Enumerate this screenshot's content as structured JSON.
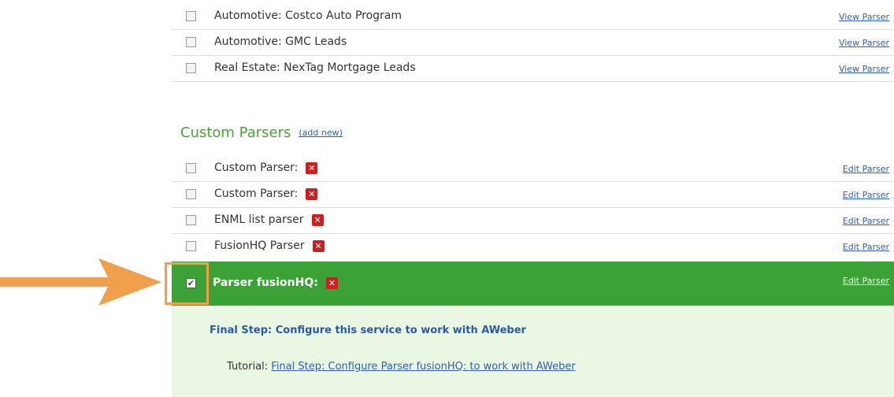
{
  "prebuilt_parsers": [
    {
      "label": "Automotive: Costco Auto Program",
      "action": "View Parser"
    },
    {
      "label": "Automotive: GMC Leads",
      "action": "View Parser"
    },
    {
      "label": "Real Estate: NexTag Mortgage Leads",
      "action": "View Parser"
    }
  ],
  "custom_section": {
    "title": "Custom Parsers",
    "add_new": "(add new)"
  },
  "custom_parsers": [
    {
      "label": "Custom Parser:",
      "action": "Edit Parser"
    },
    {
      "label": "Custom Parser:",
      "action": "Edit Parser"
    },
    {
      "label": "ENML list parser",
      "action": "Edit Parser"
    },
    {
      "label": "FusionHQ Parser",
      "action": "Edit Parser"
    }
  ],
  "selected_parser": {
    "label": "Parser fusionHQ:",
    "action": "Edit Parser",
    "checked": true
  },
  "panel": {
    "final_step": "Final Step: Configure this service to work with AWeber",
    "tutorial_label": "Tutorial:",
    "tutorial_link": "Final Step: Configure Parser fusionHQ: to work with AWeber"
  },
  "icons": {
    "delete": "x-icon",
    "checkmark": "check-icon",
    "arrow": "arrow-right-icon"
  },
  "colors": {
    "selected_row": "#3aa236",
    "panel_bg": "#e9f7e3",
    "section_title": "#4aa33a",
    "delete_button": "#cc1f1f",
    "highlight": "#f0a04b",
    "link": "#2f5fb5"
  }
}
